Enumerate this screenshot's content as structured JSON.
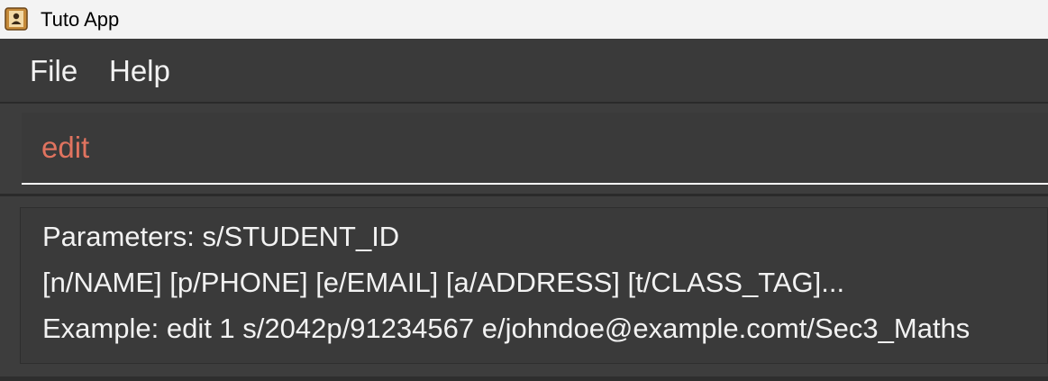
{
  "window": {
    "title": "Tuto App",
    "icon": "contact-book-icon"
  },
  "menu": {
    "items": [
      {
        "label": "File"
      },
      {
        "label": "Help"
      }
    ]
  },
  "command": {
    "value": "edit"
  },
  "result": {
    "lines": [
      "Parameters: s/STUDENT_ID",
      "[n/NAME] [p/PHONE] [e/EMAIL] [a/ADDRESS] [t/CLASS_TAG]...",
      "Example: edit 1 s/2042p/91234567 e/johndoe@example.comt/Sec3_Maths"
    ]
  },
  "colors": {
    "background": "#3a3a3a",
    "command_text": "#e0735f",
    "text": "#f2f2f2"
  }
}
